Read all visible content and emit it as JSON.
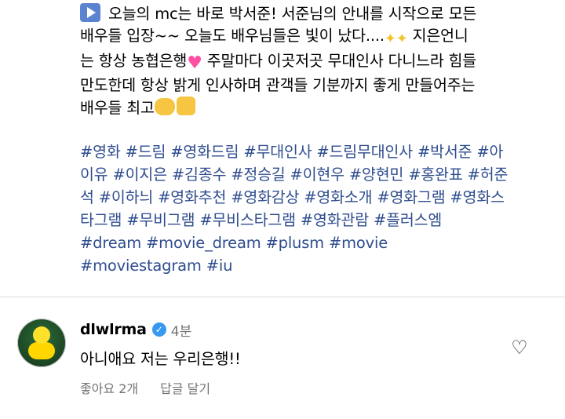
{
  "post": {
    "caption": "오늘의 mc는 바로 박서준! 서준님의 안내를 시작으로 모든\n배우들 입장~~ 오늘도 배우님들은 빛이 났다....",
    "caption_part2": " 지은언니\n는 항상 농협은행",
    "caption_part3": " 주말마다 이곳저곳 무대인사 다니느라 힘들\n만도한데 항상 밝게 인사하며 관객들 기분까지 좋게 만들어주는\n배우들 최고",
    "hashtags": "#영화 #드림 #영화드림 #무대인사 #드림무대인사 #박서준 #아\n이유 #이지은 #김종수 #정승길 #이현우 #양현민 #홍완표 #허준\n석 #이하늬 #영화추천 #영화감상 #영화소개 #영화그램 #영화스\n타그램 #무비그램 #무비스타그램 #영화관람 #플러스엠\n#dream #movie_dream #plusm #movie\n#moviestagram #iu"
  },
  "comment": {
    "username": "dlwlrma",
    "time": "4분",
    "text": "아니애요 저는 우리은행!!",
    "likes_label": "좋아요 2개",
    "reply_label": "답글 달기"
  },
  "icons": {
    "play": "play-button-icon",
    "verified": "verified-badge-icon",
    "heart": "heart-outline-icon"
  }
}
